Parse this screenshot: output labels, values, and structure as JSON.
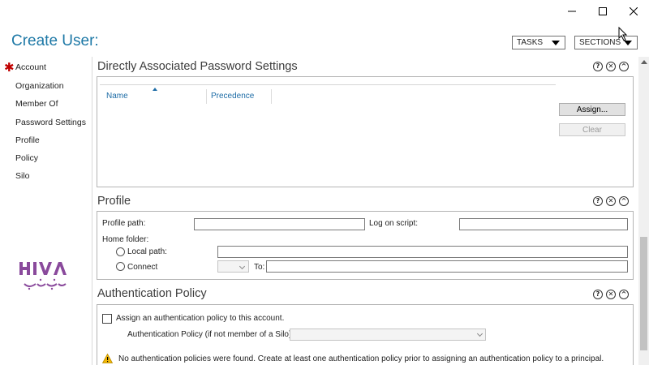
{
  "window": {
    "minimize_glyph": "—",
    "maximize_icon": "maximize-icon",
    "close_glyph": "✕"
  },
  "header": {
    "title": "Create User:",
    "tasks_label": "TASKS",
    "sections_label": "SECTIONS"
  },
  "sidebar": {
    "items": [
      {
        "label": "Account",
        "required": true
      },
      {
        "label": "Organization"
      },
      {
        "label": "Member Of"
      },
      {
        "label": "Password Settings"
      },
      {
        "label": "Profile"
      },
      {
        "label": "Policy"
      },
      {
        "label": "Silo"
      }
    ],
    "required_marker": "✱",
    "logo_alt": "Hiva Shabake logo"
  },
  "section_controls": {
    "help": "?",
    "close": "✕",
    "collapse": "^"
  },
  "password_settings": {
    "title": "Directly Associated Password Settings",
    "columns": [
      "Name",
      "Precedence"
    ],
    "assign_button": "Assign...",
    "clear_button": "Clear"
  },
  "profile": {
    "title": "Profile",
    "profile_path_label": "Profile path:",
    "profile_path_value": "",
    "logon_script_label": "Log on script:",
    "logon_script_value": "",
    "home_folder_label": "Home folder:",
    "local_path_label": "Local path:",
    "local_path_value": "",
    "connect_label": "Connect",
    "to_label": "To:",
    "to_value": ""
  },
  "auth_policy": {
    "title": "Authentication Policy",
    "assign_checkbox_label": "Assign an authentication policy to this account.",
    "policy_label": "Authentication Policy (if not member of a Silo):",
    "policy_value": "",
    "warning_text": "No authentication policies were found. Create at least one authentication policy prior to assigning an authentication policy to a principal."
  },
  "colors": {
    "accent": "#1d78a6",
    "link": "#1d6ca6",
    "required": "#c00000",
    "warning": "#f2b705"
  }
}
